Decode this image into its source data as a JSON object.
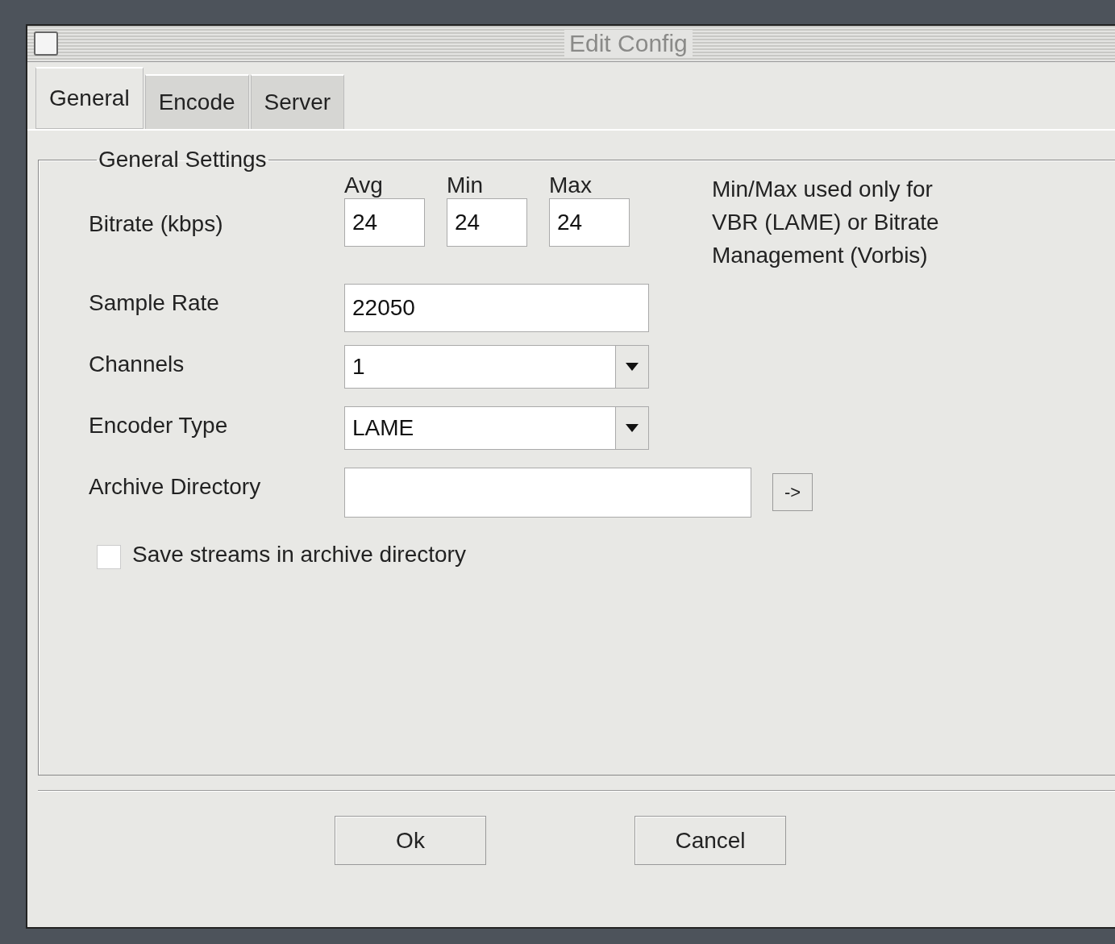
{
  "window": {
    "title": "Edit Config"
  },
  "tabs": [
    {
      "label": "General",
      "selected": true
    },
    {
      "label": "Encode",
      "selected": false
    },
    {
      "label": "Server",
      "selected": false
    }
  ],
  "group": {
    "title": "General Settings"
  },
  "bitrate": {
    "label": "Bitrate (kbps)",
    "fields": [
      {
        "header": "Avg",
        "value": "24"
      },
      {
        "header": "Min",
        "value": "24"
      },
      {
        "header": "Max",
        "value": "24"
      }
    ]
  },
  "note_lines": [
    "Min/Max used only for",
    "VBR (LAME) or Bitrate",
    "Management (Vorbis)"
  ],
  "fields": [
    {
      "kind": "text",
      "label": "Sample Rate",
      "value": "22050"
    },
    {
      "kind": "select",
      "label": "Channels",
      "value": "1"
    },
    {
      "kind": "select",
      "label": "Encoder Type",
      "value": "LAME"
    },
    {
      "kind": "browse",
      "label": "Archive Directory",
      "button": "->"
    }
  ],
  "save_streams": {
    "label": "Save streams in archive directory",
    "checked": false
  },
  "buttons": [
    "Ok",
    "Cancel"
  ]
}
